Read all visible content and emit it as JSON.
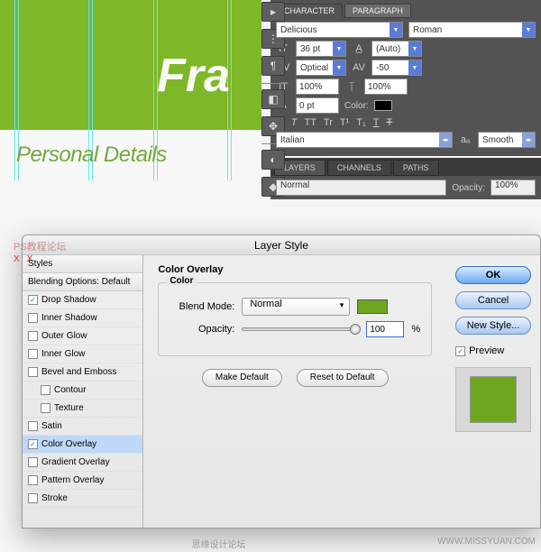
{
  "canvas": {
    "big_text": "Fra",
    "section_text": "Personal Details"
  },
  "char_panel": {
    "tabs": [
      "CHARACTER",
      "PARAGRAPH"
    ],
    "font_family": "Delicious",
    "font_style": "Roman",
    "size": "36 pt",
    "leading": "(Auto)",
    "kerning": "Optical",
    "tracking": "-50",
    "vscale": "100%",
    "hscale": "100%",
    "baseline": "0 pt",
    "color_label": "Color:",
    "type_buttons": [
      "T",
      "T",
      "TT",
      "Tr",
      "T¹",
      "T₁",
      "T",
      "Ŧ"
    ],
    "language": "Italian",
    "aa_label": "aₐ",
    "aa": "Smooth"
  },
  "layers_panel": {
    "tabs": [
      "LAYERS",
      "CHANNELS",
      "PATHS"
    ],
    "blend_mode": "Normal",
    "opacity_label": "Opacity:",
    "opacity": "100%"
  },
  "dialog": {
    "title": "Layer Style",
    "styles_label": "Styles",
    "blending_label": "Blending Options: Default",
    "items": [
      {
        "label": "Drop Shadow",
        "checked": true,
        "selected": false
      },
      {
        "label": "Inner Shadow",
        "checked": false
      },
      {
        "label": "Outer Glow",
        "checked": false
      },
      {
        "label": "Inner Glow",
        "checked": false
      },
      {
        "label": "Bevel and Emboss",
        "checked": false
      },
      {
        "label": "Contour",
        "checked": false,
        "indent": true
      },
      {
        "label": "Texture",
        "checked": false,
        "indent": true
      },
      {
        "label": "Satin",
        "checked": false
      },
      {
        "label": "Color Overlay",
        "checked": true,
        "selected": true
      },
      {
        "label": "Gradient Overlay",
        "checked": false
      },
      {
        "label": "Pattern Overlay",
        "checked": false
      },
      {
        "label": "Stroke",
        "checked": false
      }
    ],
    "section_title": "Color Overlay",
    "group_title": "Color",
    "blend_mode_label": "Blend Mode:",
    "blend_mode": "Normal",
    "opacity_label": "Opacity:",
    "opacity_value": "100",
    "percent": "%",
    "make_default": "Make Default",
    "reset_default": "Reset to Default",
    "ok": "OK",
    "cancel": "Cancel",
    "new_style": "New Style...",
    "preview": "Preview",
    "overlay_color": "#6ea71f"
  },
  "watermark": {
    "text": "PS教程论坛",
    "xx": "XX"
  },
  "footer": {
    "center": "思缘设计论坛",
    "right": "WWW.MISSYUAN.COM"
  }
}
